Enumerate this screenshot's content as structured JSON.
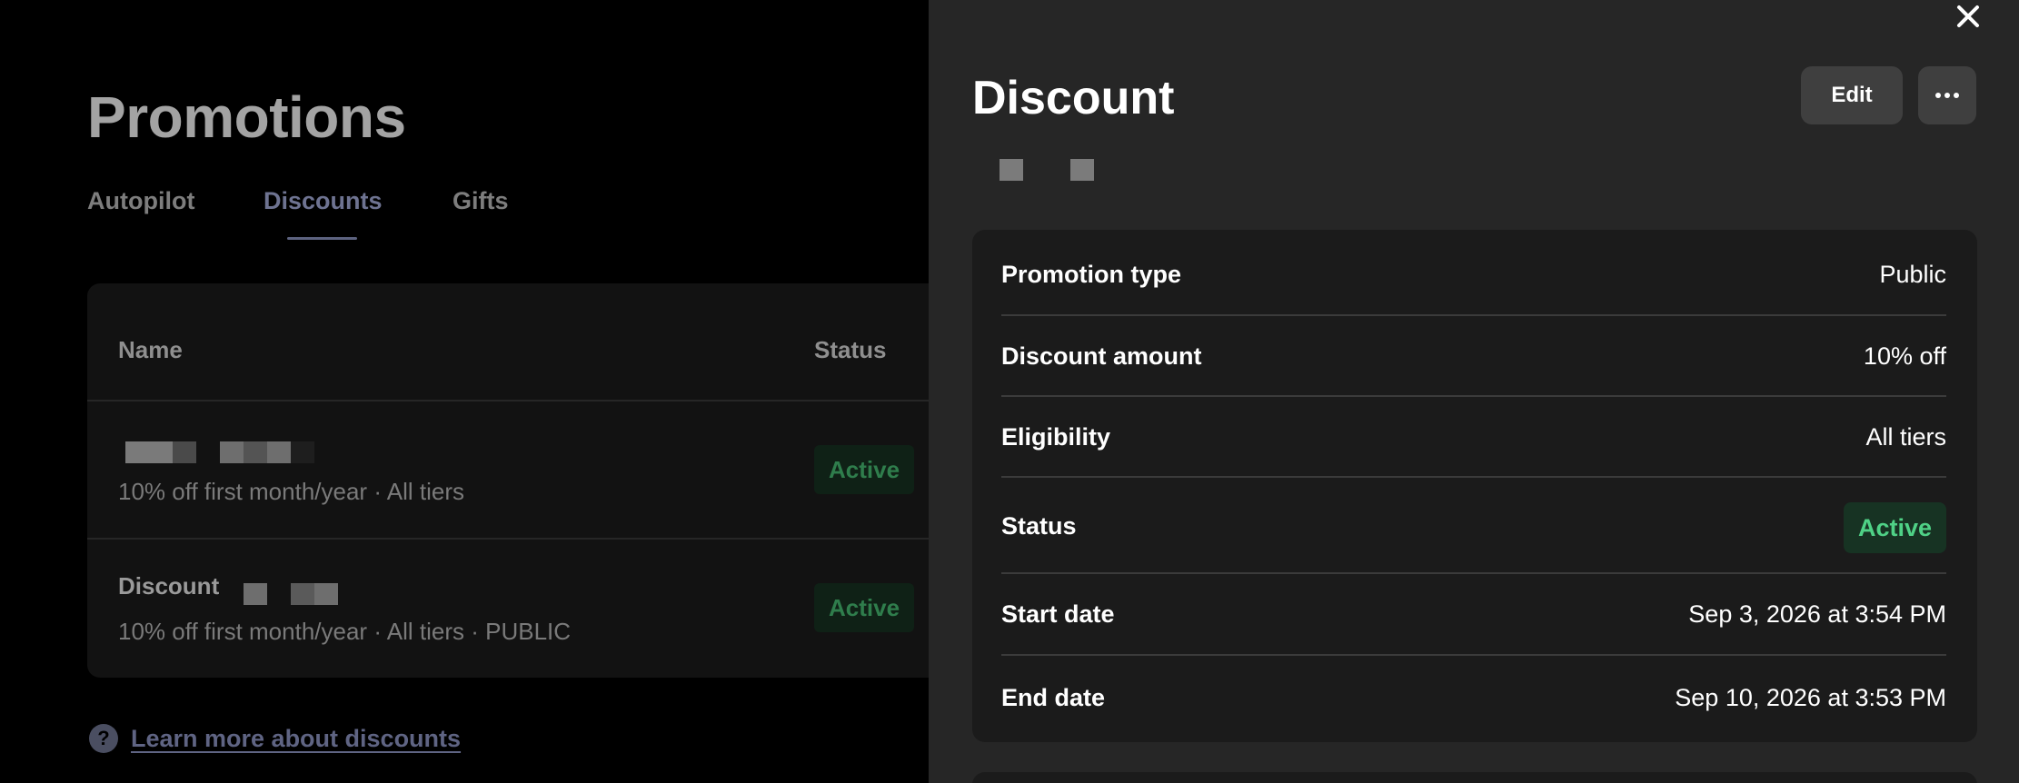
{
  "page": {
    "title": "Promotions",
    "tabs": [
      {
        "label": "Autopilot"
      },
      {
        "label": "Discounts"
      },
      {
        "label": "Gifts"
      }
    ],
    "table": {
      "headers": {
        "name": "Name",
        "status": "Status"
      },
      "rows": [
        {
          "title": "",
          "subtitle": "10% off first month/year · All tiers",
          "status": "Active"
        },
        {
          "title": "Discount",
          "subtitle": "10% off first month/year · All tiers · PUBLIC",
          "status": "Active"
        }
      ]
    },
    "learn_more": "Learn more about discounts"
  },
  "drawer": {
    "title": "Discount",
    "edit_label": "Edit",
    "details": [
      {
        "label": "Promotion type",
        "value": "Public"
      },
      {
        "label": "Discount amount",
        "value": "10% off"
      },
      {
        "label": "Eligibility",
        "value": "All tiers"
      },
      {
        "label": "Status",
        "value": "Active"
      },
      {
        "label": "Start date",
        "value": "Sep 3, 2026 at 3:54 PM"
      },
      {
        "label": "End date",
        "value": "Sep 10, 2026 at 3:53 PM"
      }
    ]
  },
  "colors": {
    "drawer_bg": "#262626",
    "card_bg": "#1b1b1b",
    "active_text": "#4fd186",
    "active_bg": "#173323"
  },
  "icons": [
    "close-icon",
    "more-icon",
    "help-icon"
  ]
}
